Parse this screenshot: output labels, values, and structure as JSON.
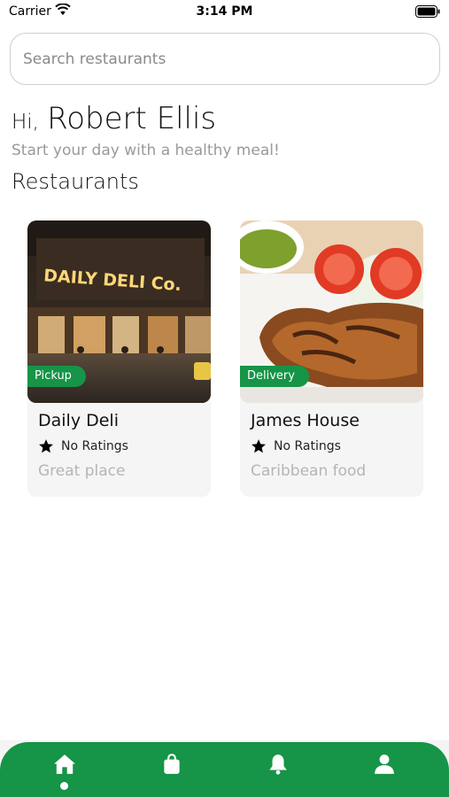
{
  "status_bar": {
    "carrier": "Carrier",
    "time": "3:14 PM",
    "icons": [
      "wifi-icon",
      "battery-icon"
    ]
  },
  "search": {
    "placeholder": "Search restaurants",
    "value": ""
  },
  "greeting": {
    "hi": "Hi,",
    "name": "Robert Ellis",
    "subtitle": "Start your day with a healthy meal!"
  },
  "section_title": "Restaurants",
  "restaurants": [
    {
      "name": "Daily Deli",
      "tag": "Pickup",
      "rating": "No Ratings",
      "description": "Great place",
      "image_sign": "DAILY DELI Co."
    },
    {
      "name": "James House",
      "tag": "Delivery",
      "rating": "No Ratings",
      "description": "Caribbean food"
    }
  ],
  "bottom_nav": {
    "items": [
      {
        "icon": "home-icon",
        "active": true
      },
      {
        "icon": "shopping-bag-icon",
        "active": false
      },
      {
        "icon": "bell-icon",
        "active": false
      },
      {
        "icon": "user-icon",
        "active": false
      }
    ]
  },
  "colors": {
    "accent": "#169447",
    "subtitle": "#9a9a9a",
    "card_bg": "#f5f5f5",
    "desc": "#b5b5b5"
  }
}
